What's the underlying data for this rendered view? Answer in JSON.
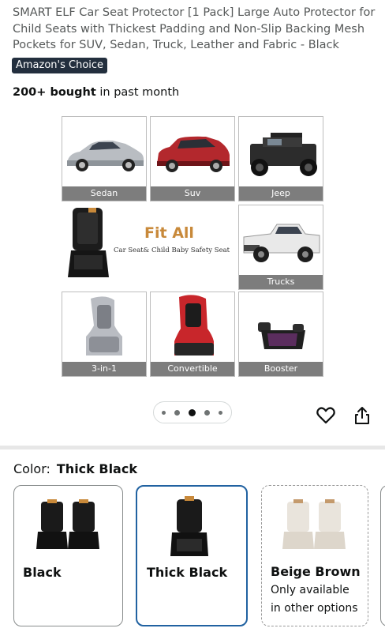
{
  "product": {
    "title": "SMART ELF Car Seat Protector [1 Pack] Large Auto Protector for Child Seats with Thickest Padding and Non-Slip Backing Mesh Pockets for SUV, Sedan, Truck, Leather and Fabric - Black",
    "badge": "Amazon's Choice",
    "bought_bold": "200+ bought",
    "bought_rest": " in past month"
  },
  "gallery": {
    "captions": {
      "sedan": "Sedan",
      "suv": "Suv",
      "jeep": "Jeep",
      "trucks": "Trucks",
      "three_in_one": "3-in-1",
      "convertible": "Convertible",
      "booster": "Booster"
    },
    "fit_title": "Fit All",
    "fit_subtitle": "Car Seat& Child Baby Safety Seat",
    "pager": {
      "count": 5,
      "active_index": 2
    }
  },
  "actions": {
    "heart_icon": "heart-outline",
    "share_icon": "share-upload"
  },
  "color": {
    "label": "Color:",
    "selected": "Thick Black",
    "options": [
      {
        "name": "Black",
        "note": ""
      },
      {
        "name": "Thick Black",
        "note": ""
      },
      {
        "name": "Beige Brown",
        "note": "Only available",
        "note2": "in other options"
      }
    ]
  },
  "colors": {
    "badge_bg": "#232f3e",
    "selected_border": "#2162a1",
    "fit_title": "#c8893a",
    "caption_bg": "#7d7d7d"
  }
}
